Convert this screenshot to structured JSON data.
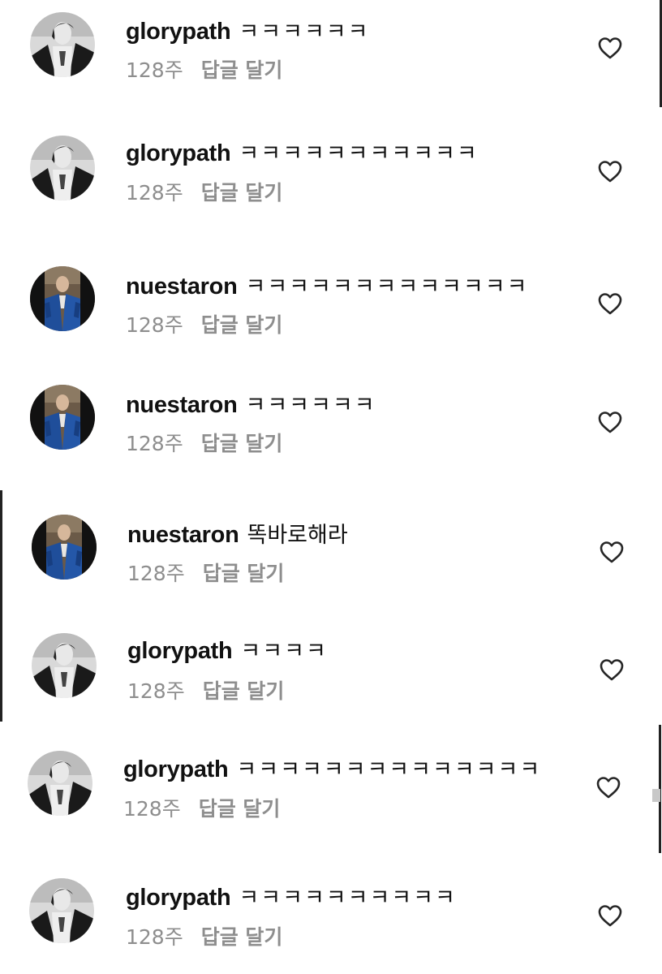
{
  "colors": {
    "text": "#111111",
    "meta": "#8e8e8e",
    "heart_stroke": "#262626"
  },
  "comments": [
    {
      "username": "glorypath",
      "text": "ㅋㅋㅋㅋㅋㅋ",
      "time": "128주",
      "reply": "답글 달기",
      "avatar": "glorypath",
      "heart_icon": "heart-outline-icon"
    },
    {
      "username": "glorypath",
      "text": "ㅋㅋㅋㅋㅋㅋㅋㅋㅋㅋㅋ",
      "time": "128주",
      "reply": "답글 달기",
      "avatar": "glorypath",
      "heart_icon": "heart-outline-icon"
    },
    {
      "username": "nuestaron",
      "text": "ㅋㅋㅋㅋㅋㅋㅋㅋㅋㅋㅋㅋㅋ",
      "time": "128주",
      "reply": "답글 달기",
      "avatar": "nuestaron",
      "heart_icon": "heart-outline-icon"
    },
    {
      "username": "nuestaron",
      "text": "ㅋㅋㅋㅋㅋㅋ",
      "time": "128주",
      "reply": "답글 달기",
      "avatar": "nuestaron",
      "heart_icon": "heart-outline-icon"
    },
    {
      "username": "nuestaron",
      "text": "똑바로해라",
      "time": "128주",
      "reply": "답글 달기",
      "avatar": "nuestaron",
      "heart_icon": "heart-outline-icon"
    },
    {
      "username": "glorypath",
      "text": "ㅋㅋㅋㅋ",
      "time": "128주",
      "reply": "답글 달기",
      "avatar": "glorypath",
      "heart_icon": "heart-outline-icon"
    },
    {
      "username": "glorypath",
      "text": "ㅋㅋㅋㅋㅋㅋㅋㅋㅋㅋㅋㅋㅋㅋ",
      "time": "128주",
      "reply": "답글 달기",
      "avatar": "glorypath",
      "heart_icon": "heart-outline-icon"
    },
    {
      "username": "glorypath",
      "text": "ㅋㅋㅋㅋㅋㅋㅋㅋㅋㅋ",
      "time": "128주",
      "reply": "답글 달기",
      "avatar": "glorypath",
      "heart_icon": "heart-outline-icon"
    }
  ]
}
